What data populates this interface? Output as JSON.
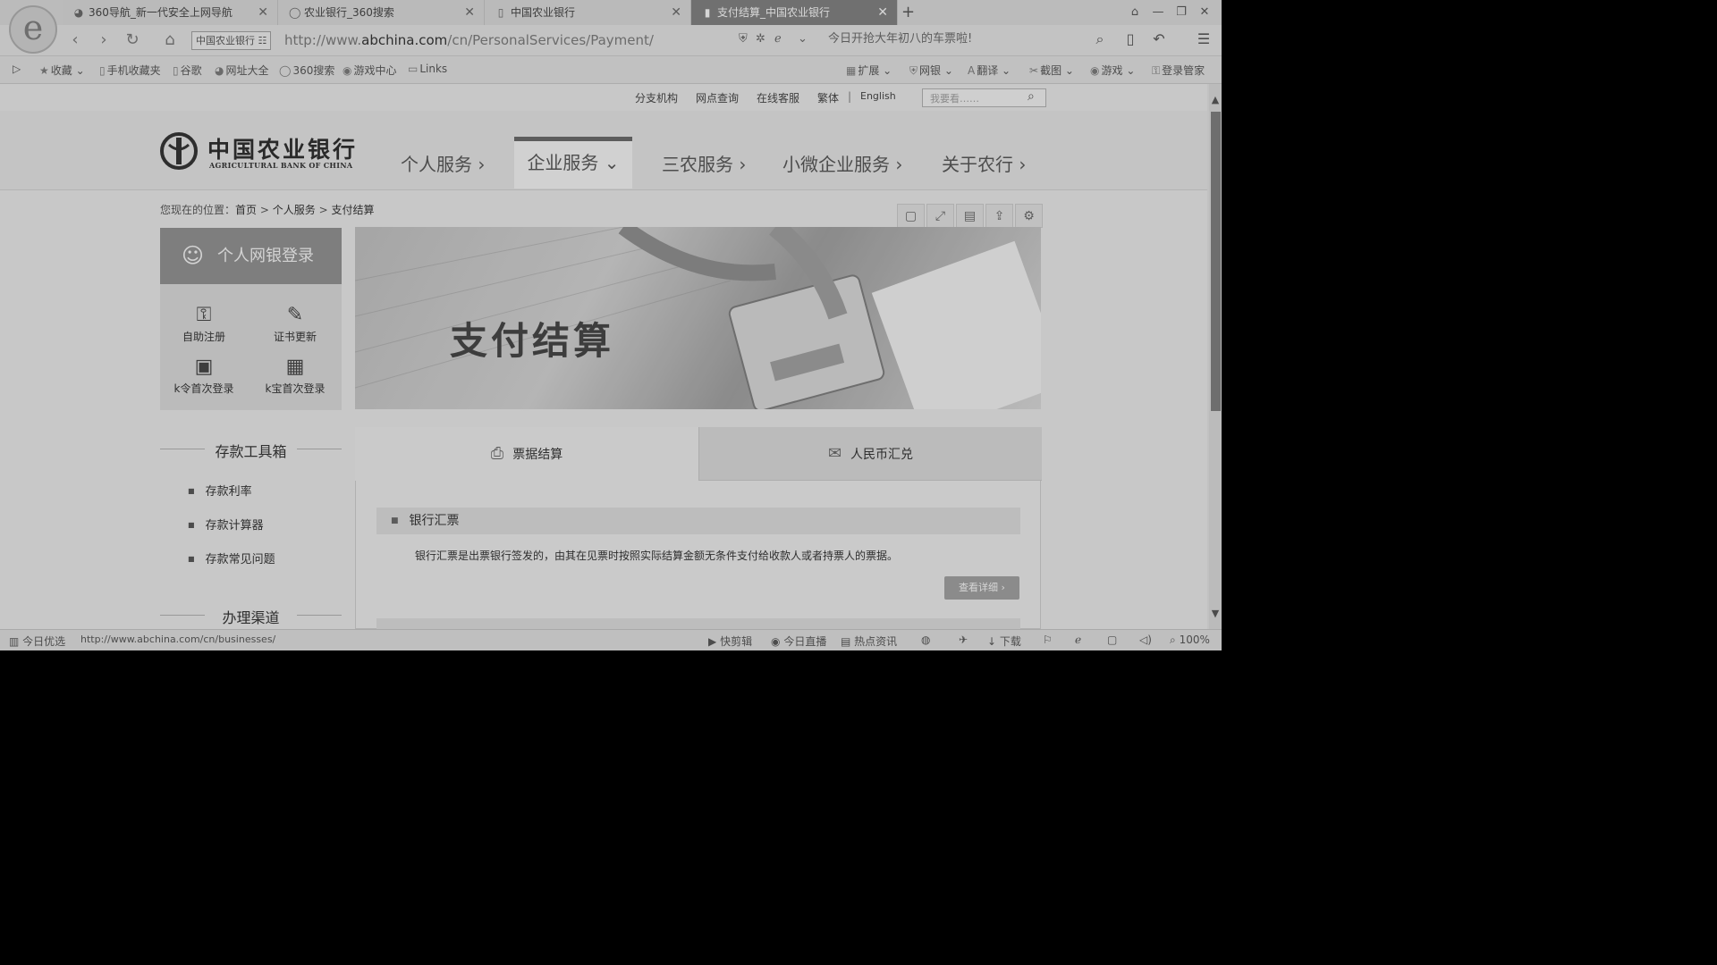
{
  "tabs": [
    {
      "icon": "360-browser-icon",
      "label": "360导航_新一代安全上网导航",
      "active": false
    },
    {
      "icon": "search-icon",
      "label": "农业银行_360搜索",
      "active": false
    },
    {
      "icon": "page-icon",
      "label": "中国农业银行",
      "active": false
    },
    {
      "icon": "page-icon",
      "label": "支付结算_中国农业银行",
      "active": true
    }
  ],
  "address": {
    "site_badge": "中国农业银行",
    "url_prefix": "http://www.",
    "url_domain": "abchina.com",
    "url_path": "/cn/PersonalServices/Payment/",
    "search_text": "今日开抢大年初八的车票啦!"
  },
  "bookmarks": [
    "收藏",
    "手机收藏夹",
    "谷歌",
    "网址大全",
    "360搜索",
    "游戏中心",
    "Links"
  ],
  "toolbar_right": [
    "扩展",
    "网银",
    "翻译",
    "截图",
    "游戏",
    "登录管家"
  ],
  "topnav": [
    "分支机构",
    "网点查询",
    "在线客服",
    "繁体",
    "English"
  ],
  "site_search_placeholder": "我要看……",
  "brand": {
    "cn": "中国农业银行",
    "en": "AGRICULTURAL BANK OF CHINA"
  },
  "mainnav": [
    {
      "label": "个人服务 ›"
    },
    {
      "label": "企业服务 ⌄"
    },
    {
      "label": "三农服务 ›"
    },
    {
      "label": "小微企业服务 ›"
    },
    {
      "label": "关于农行 ›"
    }
  ],
  "breadcrumb": {
    "prefix": "您现在的位置：",
    "home": "首页",
    "sep": ">",
    "section": "个人服务",
    "current": "支付结算"
  },
  "login": {
    "label": "个人网银登录"
  },
  "quick_links": [
    "自助注册",
    "证书更新",
    "k令首次登录",
    "k宝首次登录"
  ],
  "deposit_tools": {
    "title": "存款工具箱",
    "links": [
      "存款利率",
      "存款计算器",
      "存款常见问题"
    ]
  },
  "channels_title": "办理渠道",
  "banner_title": "支付结算",
  "content_tabs": [
    {
      "label": "票据结算",
      "icon": "printer-icon"
    },
    {
      "label": "人民币汇兑",
      "icon": "remittance-icon"
    }
  ],
  "item": {
    "title": "银行汇票",
    "desc": "银行汇票是出票银行签发的，由其在见票时按照实际结算金额无条件支付给收款人或者持票人的票据。",
    "button": "查看详细 ›"
  },
  "status": {
    "left_label": "今日优选",
    "hover_url": "http://www.abchina.com/cn/businesses/",
    "items": [
      "快剪辑",
      "今日直播",
      "热点资讯",
      "下载"
    ],
    "zoom": "100%"
  }
}
